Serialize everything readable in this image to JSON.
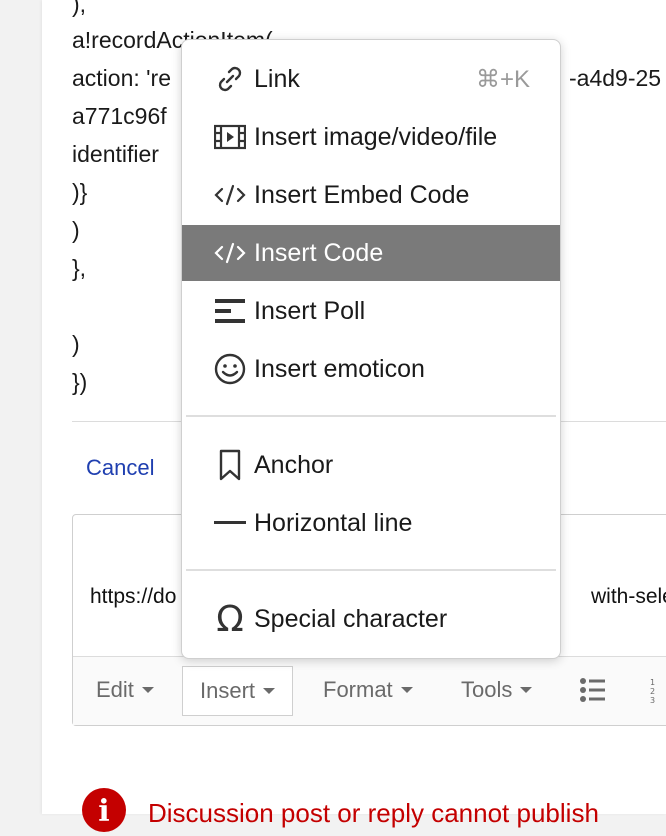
{
  "code_lines": [
    "),",
    "a!recordActionItem(",
    "action: 're",
    "a771c96f",
    "identifier",
    ")}",
    ")",
    "},",
    "",
    ")",
    "})"
  ],
  "code_line_right": "-a4d9-25",
  "cancel_label": "Cancel",
  "editor": {
    "text_left": "https://do",
    "text_right": "with-selec"
  },
  "toolbar": {
    "edit": "Edit",
    "insert": "Insert",
    "format": "Format",
    "tools": "Tools"
  },
  "error_text": "Discussion post or reply cannot publish",
  "menu": {
    "items": [
      {
        "label": "Link",
        "shortcut": "⌘+K",
        "icon": "link-icon"
      },
      {
        "label": "Insert image/video/file",
        "icon": "media-icon"
      },
      {
        "label": "Insert Embed Code",
        "icon": "embed-code-icon"
      },
      {
        "label": "Insert Code",
        "icon": "code-icon",
        "highlighted": true
      },
      {
        "label": "Insert Poll",
        "icon": "poll-icon"
      },
      {
        "label": "Insert emoticon",
        "icon": "emoticon-icon"
      },
      {
        "label": "Anchor",
        "icon": "bookmark-icon"
      },
      {
        "label": "Horizontal line",
        "icon": "horizontal-line-icon"
      },
      {
        "label": "Special character",
        "icon": "omega-icon"
      }
    ]
  },
  "colors": {
    "highlight": "#7a7a7a",
    "link": "#1f3fb0",
    "error": "#c40000"
  }
}
